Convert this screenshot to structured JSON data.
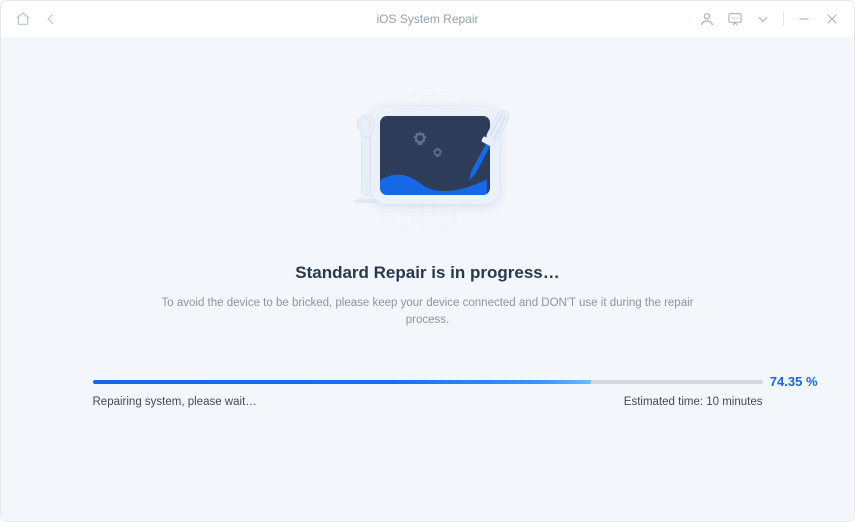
{
  "titlebar": {
    "title": "iOS System Repair"
  },
  "main": {
    "heading": "Standard Repair is in progress…",
    "subtext": "To avoid the device to be bricked, please keep your device connected and DON'T use it during the repair process."
  },
  "progress": {
    "percent": 74.35,
    "percent_label": "74.35 %",
    "status_text": "Repairing system, please wait…",
    "estimated_time_text": "Estimated time: 10 minutes"
  },
  "colors": {
    "accent": "#1768e6",
    "bg": "#f3f6fb",
    "heading": "#27394f",
    "muted": "#8a95a6"
  }
}
